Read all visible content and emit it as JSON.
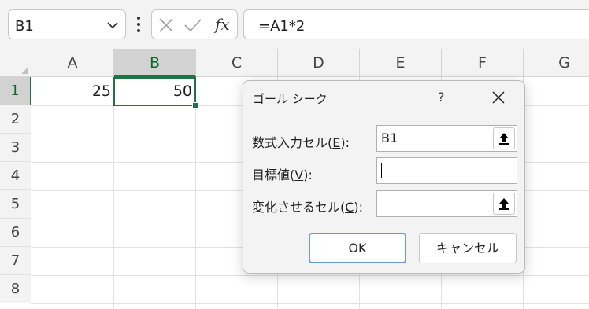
{
  "formula_bar": {
    "name_box": "B1",
    "formula": "=A1*2",
    "fx_label": "fx"
  },
  "columns": [
    "A",
    "B",
    "C",
    "D",
    "E",
    "F",
    "G"
  ],
  "rows": [
    "1",
    "2",
    "3",
    "4",
    "5",
    "6",
    "7",
    "8"
  ],
  "cells": {
    "A1": "25",
    "B1": "50"
  },
  "dialog": {
    "title": "ゴール シーク",
    "help": "?",
    "set_cell_label_pre": "数式入力セル(",
    "set_cell_label_key": "E",
    "set_cell_label_post": "):",
    "set_cell_value": "B1",
    "to_value_label_pre": "目標値(",
    "to_value_label_key": "V",
    "to_value_label_post": "):",
    "to_value_value": "",
    "changing_cell_label_pre": "変化させるセル(",
    "changing_cell_label_key": "C",
    "changing_cell_label_post": "):",
    "changing_cell_value": "",
    "ok_label": "OK",
    "cancel_label": "キャンセル"
  },
  "colors": {
    "selection": "#217346",
    "accent_button": "#6a9bd1"
  }
}
